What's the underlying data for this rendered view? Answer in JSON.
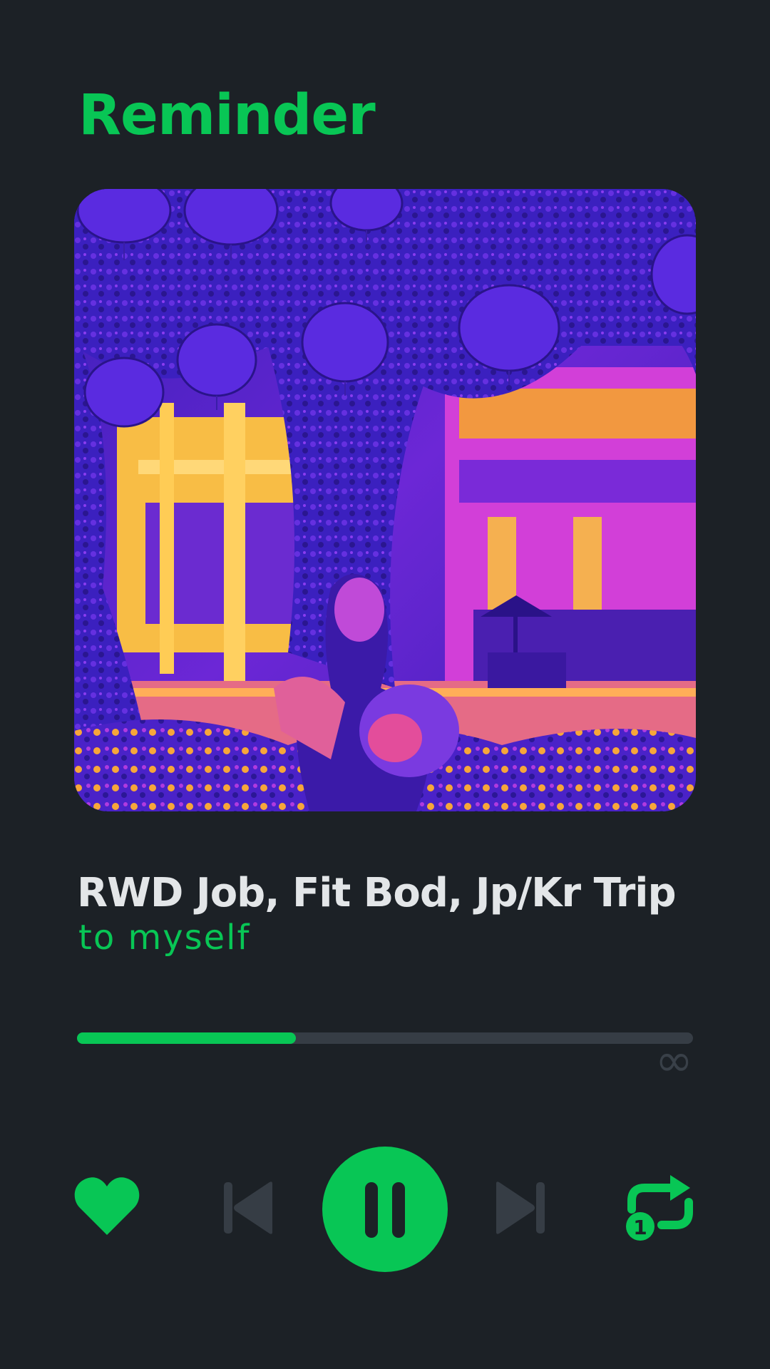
{
  "header": {
    "title": "Reminder"
  },
  "artwork": {
    "description_icon": "album-art-image"
  },
  "track": {
    "title": "RWD Job, Fit Bod, Jp/Kr Trip",
    "artist": "to myself"
  },
  "progress": {
    "fraction": 0.355,
    "duration_label": "∞"
  },
  "controls": {
    "like_icon": "heart-icon",
    "previous_icon": "skip-previous-icon",
    "play_pause_icon": "pause-icon",
    "next_icon": "skip-next-icon",
    "repeat_icon": "repeat-one-icon",
    "repeat_badge": "1"
  },
  "colors": {
    "background": "#1c2126",
    "accent": "#08c655",
    "text": "#e3e6e8",
    "muted": "#363d45"
  }
}
